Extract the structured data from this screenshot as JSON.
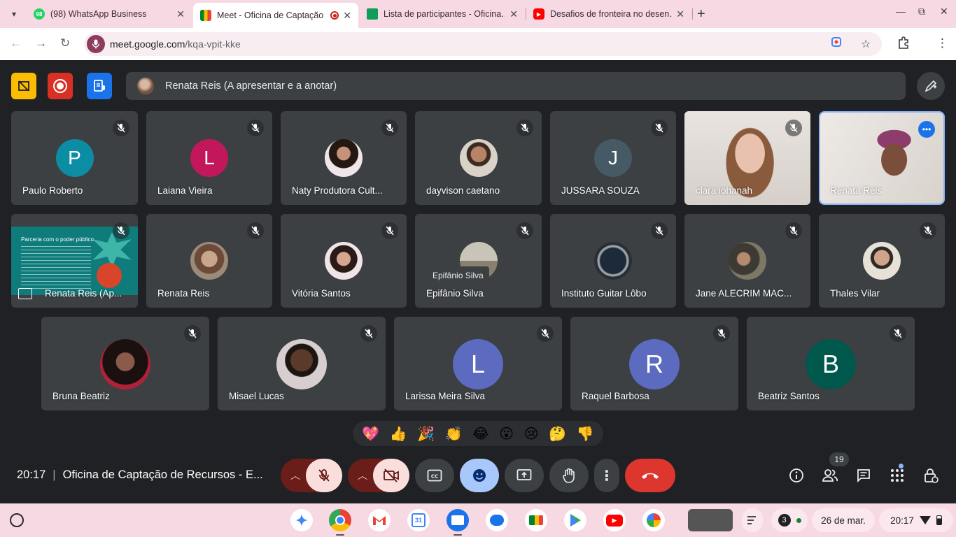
{
  "browser": {
    "tabs": [
      {
        "title": "(98) WhatsApp Business",
        "favicon": "whatsapp-icon",
        "badge": "98"
      },
      {
        "title": "Meet - Oficina de Captação",
        "favicon": "meet-icon"
      },
      {
        "title": "Lista de participantes - Oficina…",
        "favicon": "sheets-icon"
      },
      {
        "title": "Desafios de fronteira no desen…",
        "favicon": "youtube-icon"
      }
    ],
    "url_host": "meet.google.com",
    "url_path": "/kqa-vpit-kke"
  },
  "meet": {
    "presenter_banner": "Renata Reis (A apresentar e a anotar)",
    "hover_label": "Epifânio Silva",
    "slide_title": "Parceria com o poder público",
    "participants_row1": [
      {
        "name": "Paulo Roberto",
        "initial": "P",
        "color": "#0b8da3"
      },
      {
        "name": "Laiana Vieira",
        "initial": "L",
        "color": "#c2185b"
      },
      {
        "name": "Naty Produtora Cult...",
        "photo": true
      },
      {
        "name": "dayvison caetano",
        "photo": true
      },
      {
        "name": "JUSSARA SOUZA",
        "initial": "J",
        "color": "#455a64"
      },
      {
        "name": "clara iohanah",
        "video": true
      },
      {
        "name": "Renata Reis",
        "video": true
      }
    ],
    "participants_row2": [
      {
        "name": "Renata Reis (Ap..."
      },
      {
        "name": "Renata Reis"
      },
      {
        "name": "Vitória Santos"
      },
      {
        "name": "Epifânio Silva"
      },
      {
        "name": "Instituto Guitar Lôbo"
      },
      {
        "name": "Jane ALECRIM MAC..."
      },
      {
        "name": "Thales Vilar"
      }
    ],
    "participants_row3": [
      {
        "name": "Bruna Beatriz"
      },
      {
        "name": "Misael Lucas"
      },
      {
        "name": "Larissa Meira Silva",
        "initial": "L",
        "color": "#5c6bc0"
      },
      {
        "name": "Raquel Barbosa",
        "initial": "R",
        "color": "#5c6bc0"
      },
      {
        "name": "Beatriz Santos",
        "initial": "B",
        "color": "#00574b"
      }
    ],
    "reactions": [
      "💖",
      "👍",
      "🎉",
      "👏",
      "😂",
      "😮",
      "😢",
      "🤔",
      "👎"
    ],
    "time": "20:17",
    "meeting_title": "Oficina de Captação de Recursos - E...",
    "people_count": "19"
  },
  "shelf": {
    "notifications": "3",
    "date": "26 de mar.",
    "time": "20:17"
  },
  "colors": {
    "tab_strip": "#f7d9e4",
    "meet_bg": "#202124",
    "tile_bg": "#3c4043",
    "end_call": "#dc362e"
  }
}
